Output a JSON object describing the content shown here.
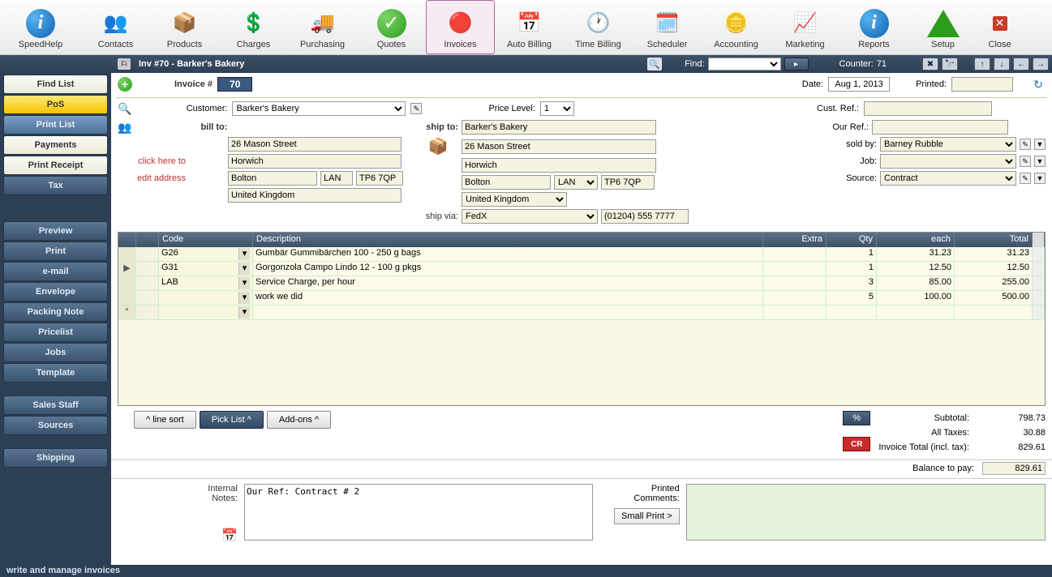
{
  "toolbar": {
    "speedhelp": "SpeedHelp",
    "items": [
      "Contacts",
      "Products",
      "Charges",
      "Purchasing",
      "Quotes",
      "Invoices",
      "Auto Billing",
      "Time Billing",
      "Scheduler",
      "Accounting",
      "Marketing",
      "Reports",
      "Setup",
      "Close"
    ]
  },
  "titlebar": {
    "fi": "Fi",
    "title": "Inv #70 - Barker's Bakery",
    "find_label": "Find:",
    "counter_label": "Counter:",
    "counter_value": "71"
  },
  "sidebar": {
    "find_list": "Find List",
    "pos": "PoS",
    "print_list": "Print List",
    "payments": "Payments",
    "print_receipt": "Print Receipt",
    "tax": "Tax",
    "preview": "Preview",
    "print": "Print",
    "email": "e-mail",
    "envelope": "Envelope",
    "packing_note": "Packing Note",
    "pricelist": "Pricelist",
    "jobs": "Jobs",
    "template": "Template",
    "sales_staff": "Sales Staff",
    "sources": "Sources",
    "shipping": "Shipping"
  },
  "header": {
    "invoice_num_label": "Invoice #",
    "invoice_num": "70",
    "date_label": "Date:",
    "date": "Aug 1, 2013",
    "printed_label": "Printed:",
    "printed": "",
    "customer_label": "Customer:",
    "customer": "Barker's Bakery",
    "price_level_label": "Price Level:",
    "price_level": "1",
    "cust_ref_label": "Cust. Ref.:",
    "cust_ref": ""
  },
  "bill": {
    "label": "bill to:",
    "edit_hint1": "click here to",
    "edit_hint2": "edit address",
    "street": "26 Mason Street",
    "city": "Horwich",
    "town": "Bolton",
    "region": "LAN",
    "postcode": "TP6 7QP",
    "country": "United Kingdom"
  },
  "ship": {
    "label": "ship to:",
    "name": "Barker's Bakery",
    "street": "26 Mason Street",
    "city": "Horwich",
    "town": "Bolton",
    "region": "LAN",
    "postcode": "TP6 7QP",
    "country": "United Kingdom",
    "via_label": "ship via:",
    "via": "FedX",
    "phone": "(01204) 555 7777"
  },
  "right": {
    "our_ref_label": "Our Ref.:",
    "our_ref": "",
    "sold_by_label": "sold by:",
    "sold_by": "Barney Rubble",
    "job_label": "Job:",
    "job": "",
    "source_label": "Source:",
    "source": "Contract"
  },
  "grid": {
    "headers": {
      "code": "Code",
      "desc": "Description",
      "extra": "Extra",
      "qty": "Qty",
      "each": "each",
      "total": "Total"
    },
    "rows": [
      {
        "sel": "",
        "code": "G26",
        "desc": "Gumbär Gummibärchen 100 - 250 g bags",
        "extra": "",
        "qty": "1",
        "each": "31.23",
        "total": "31.23"
      },
      {
        "sel": "▶",
        "code": "G31",
        "desc": "Gorgonzola Campo Lindo 12 - 100 g pkgs",
        "extra": "",
        "qty": "1",
        "each": "12.50",
        "total": "12.50"
      },
      {
        "sel": "",
        "code": "LAB",
        "desc": "Service Charge, per hour",
        "extra": "",
        "qty": "3",
        "each": "85.00",
        "total": "255.00"
      },
      {
        "sel": "",
        "code": "",
        "desc": "work we did",
        "extra": "",
        "qty": "5",
        "each": "100.00",
        "total": "500.00"
      }
    ],
    "new_marker": "*"
  },
  "actions": {
    "line_sort": "^ line sort",
    "pick_list": "Pick List ^",
    "addons": "Add-ons ^",
    "pct": "%",
    "cr": "CR"
  },
  "totals": {
    "subtotal_label": "Subtotal:",
    "subtotal": "798.73",
    "taxes_label": "All Taxes:",
    "taxes": "30.88",
    "total_label": "Invoice Total (incl. tax):",
    "total": "829.61",
    "balance_label": "Balance to pay:",
    "balance": "829.61"
  },
  "notes": {
    "internal_label1": "Internal",
    "internal_label2": "Notes:",
    "internal": "Our Ref: Contract # 2",
    "printed_label1": "Printed",
    "printed_label2": "Comments:",
    "small_print": "Small Print >"
  },
  "status": "write and manage invoices"
}
